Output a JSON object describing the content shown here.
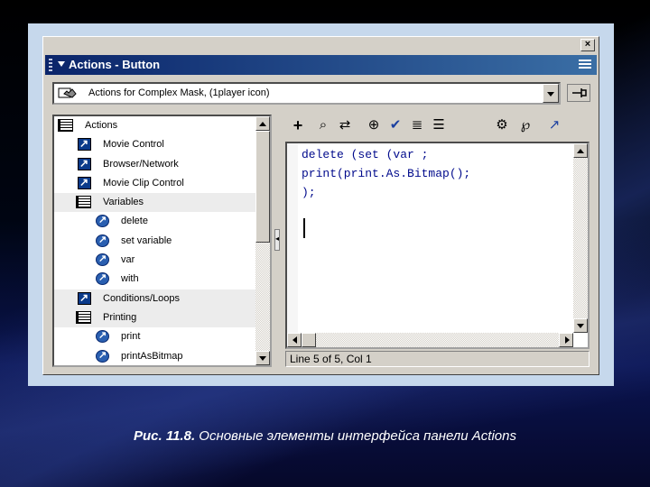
{
  "window": {
    "close_label": "×",
    "title": "Actions - Button"
  },
  "dropdown": {
    "value": "Actions for Complex Mask, (1player icon)"
  },
  "tree": {
    "items": [
      {
        "label": "Actions",
        "icon": "book-icon",
        "level": 0
      },
      {
        "label": "Movie Control",
        "icon": "action-icon",
        "level": 1
      },
      {
        "label": "Browser/Network",
        "icon": "action-icon",
        "level": 1
      },
      {
        "label": "Movie Clip Control",
        "icon": "action-icon",
        "level": 1
      },
      {
        "label": "Variables",
        "icon": "book-icon",
        "level": 1
      },
      {
        "label": "delete",
        "icon": "circle-action-icon",
        "level": 2
      },
      {
        "label": "set variable",
        "icon": "circle-action-icon",
        "level": 2
      },
      {
        "label": "var",
        "icon": "circle-action-icon",
        "level": 2
      },
      {
        "label": "with",
        "icon": "circle-action-icon",
        "level": 2
      },
      {
        "label": "Conditions/Loops",
        "icon": "action-icon",
        "level": 1
      },
      {
        "label": "Printing",
        "icon": "book-icon",
        "level": 1
      },
      {
        "label": "print",
        "icon": "circle-action-icon",
        "level": 2
      },
      {
        "label": "printAsBitmap",
        "icon": "circle-action-icon",
        "level": 2
      }
    ]
  },
  "toolbar": {
    "add": "+",
    "find": "⌕",
    "replace": "⇄",
    "target": "⊕",
    "check": "✔",
    "format": "≣",
    "hints": "☰",
    "reference": "⚙",
    "debug": "℘",
    "view": "↗"
  },
  "editor": {
    "line1": "delete (set (var ;",
    "line2": "print(print.As.Bitmap();",
    "line3": ");"
  },
  "status": {
    "text": "Line 5 of 5, Col 1"
  },
  "caption": {
    "prefix": "Рис. 11.8.",
    "text": " Основные элементы интерфейса панели Actions"
  }
}
